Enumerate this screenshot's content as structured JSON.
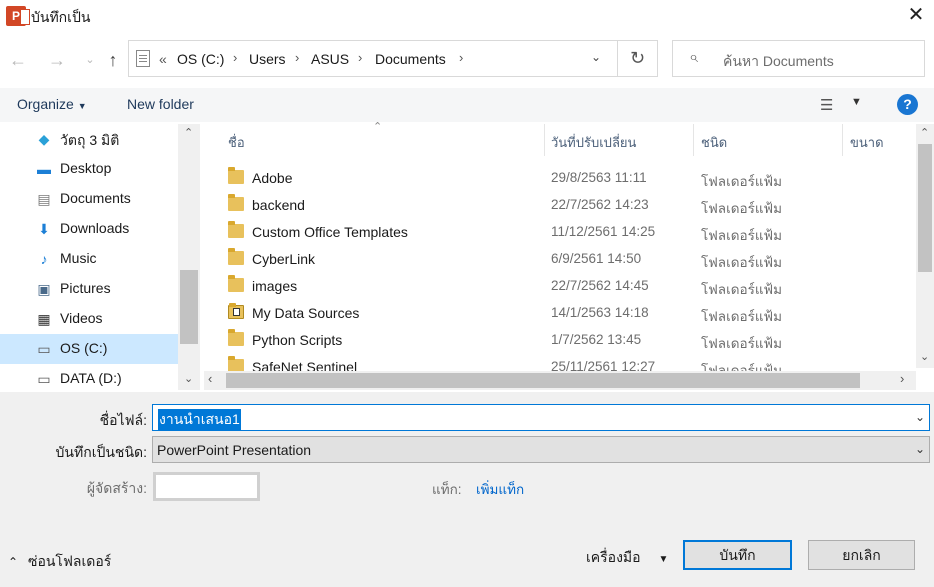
{
  "window": {
    "title": "บันทึกเป็น",
    "app_icon_letter": "P"
  },
  "address": {
    "prefix": "«",
    "crumbs": [
      "OS (C:)",
      "Users",
      "ASUS",
      "Documents"
    ],
    "search_placeholder": "ค้นหา Documents"
  },
  "toolbar": {
    "organize": "Organize",
    "new_folder": "New folder",
    "help": "?"
  },
  "nav": {
    "items": [
      {
        "label": "วัตถุ 3 มิติ",
        "icon": "3d-objects-icon",
        "glyph": "◆",
        "color": "#2aa1d8"
      },
      {
        "label": "Desktop",
        "icon": "desktop-icon",
        "glyph": "▬",
        "color": "#1c7fd6"
      },
      {
        "label": "Documents",
        "icon": "documents-icon",
        "glyph": "▤",
        "color": "#7a7a7a"
      },
      {
        "label": "Downloads",
        "icon": "downloads-icon",
        "glyph": "⬇",
        "color": "#1c7fd6"
      },
      {
        "label": "Music",
        "icon": "music-icon",
        "glyph": "♪",
        "color": "#1c7fd6"
      },
      {
        "label": "Pictures",
        "icon": "pictures-icon",
        "glyph": "▣",
        "color": "#4a6a8a"
      },
      {
        "label": "Videos",
        "icon": "videos-icon",
        "glyph": "▦",
        "color": "#333"
      },
      {
        "label": "OS (C:)",
        "icon": "drive-icon",
        "glyph": "▭",
        "color": "#555"
      },
      {
        "label": "DATA (D:)",
        "icon": "drive-icon",
        "glyph": "▭",
        "color": "#555"
      }
    ],
    "selected_index": 7
  },
  "list": {
    "columns": {
      "name": "ชื่อ",
      "date": "วันที่ปรับเปลี่ยน",
      "type": "ชนิด",
      "size": "ขนาด"
    },
    "rows": [
      {
        "name": "Adobe",
        "date": "29/8/2563 11:11",
        "type": "โฟลเดอร์แฟ้ม",
        "special": false
      },
      {
        "name": "backend",
        "date": "22/7/2562 14:23",
        "type": "โฟลเดอร์แฟ้ม",
        "special": false
      },
      {
        "name": "Custom Office Templates",
        "date": "11/12/2561 14:25",
        "type": "โฟลเดอร์แฟ้ม",
        "special": false
      },
      {
        "name": "CyberLink",
        "date": "6/9/2561 14:50",
        "type": "โฟลเดอร์แฟ้ม",
        "special": false
      },
      {
        "name": "images",
        "date": "22/7/2562 14:45",
        "type": "โฟลเดอร์แฟ้ม",
        "special": false
      },
      {
        "name": "My Data Sources",
        "date": "14/1/2563 14:18",
        "type": "โฟลเดอร์แฟ้ม",
        "special": true
      },
      {
        "name": "Python Scripts",
        "date": "1/7/2562 13:45",
        "type": "โฟลเดอร์แฟ้ม",
        "special": false
      },
      {
        "name": "SafeNet Sentinel",
        "date": "25/11/2561 12:27",
        "type": "โฟลเดอร์แฟ้ม",
        "special": false
      }
    ]
  },
  "form": {
    "filename_label": "ชื่อไฟล์:",
    "filename_value": "งานนำเสนอ1",
    "filetype_label": "บันทึกเป็นชนิด:",
    "filetype_value": "PowerPoint Presentation",
    "author_label": "ผู้จัดสร้าง:",
    "author_value": "",
    "tags_label": "แท็ก:",
    "tags_link": "เพิ่มแท็ก"
  },
  "footer": {
    "hide_folders": "ซ่อนโฟลเดอร์",
    "tools": "เครื่องมือ",
    "save": "บันทึก",
    "cancel": "ยกเลิก"
  }
}
